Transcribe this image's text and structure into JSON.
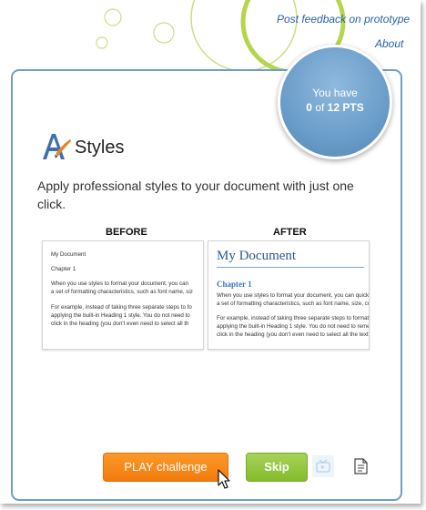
{
  "links": {
    "feedback": "Post feedback on prototype",
    "about": "About"
  },
  "points": {
    "line1": "You have",
    "score": "0",
    "of": "of",
    "total": "12 PTS"
  },
  "feature": {
    "title": "Styles",
    "description": "Apply professional styles to your document with just one click."
  },
  "comparison": {
    "before_label": "BEFORE",
    "after_label": "AFTER",
    "before": {
      "doc_title": "My Document",
      "heading": "Chapter 1",
      "lines": [
        "When you use styles to format your document, you can",
        "a set of formatting characteristics, such as font name, siz",
        "For example, instead of taking three separate steps to fo",
        "applying the built-in Heading 1 style. You do not need to",
        "click in the heading (you don't even need to select all th"
      ]
    },
    "after": {
      "doc_title": "My Document",
      "heading": "Chapter 1",
      "lines": [
        "When you use styles to format your document, you can quickl",
        "a set of formatting characteristics, such as font name, size, colo",
        "For example, instead of taking three separate steps to format",
        "applying the built-in Heading 1 style. You do not need to reme",
        "click in the heading (you don't even need to select all the text),"
      ]
    }
  },
  "buttons": {
    "play": "PLAY challenge",
    "skip": "Skip"
  },
  "icons": {
    "video": "video-icon",
    "document": "document-icon",
    "cursor": "mouse-cursor-icon"
  },
  "colors": {
    "accent_blue": "#6a9dc9",
    "play_orange": "#f58a1a",
    "skip_green": "#92c43b"
  }
}
